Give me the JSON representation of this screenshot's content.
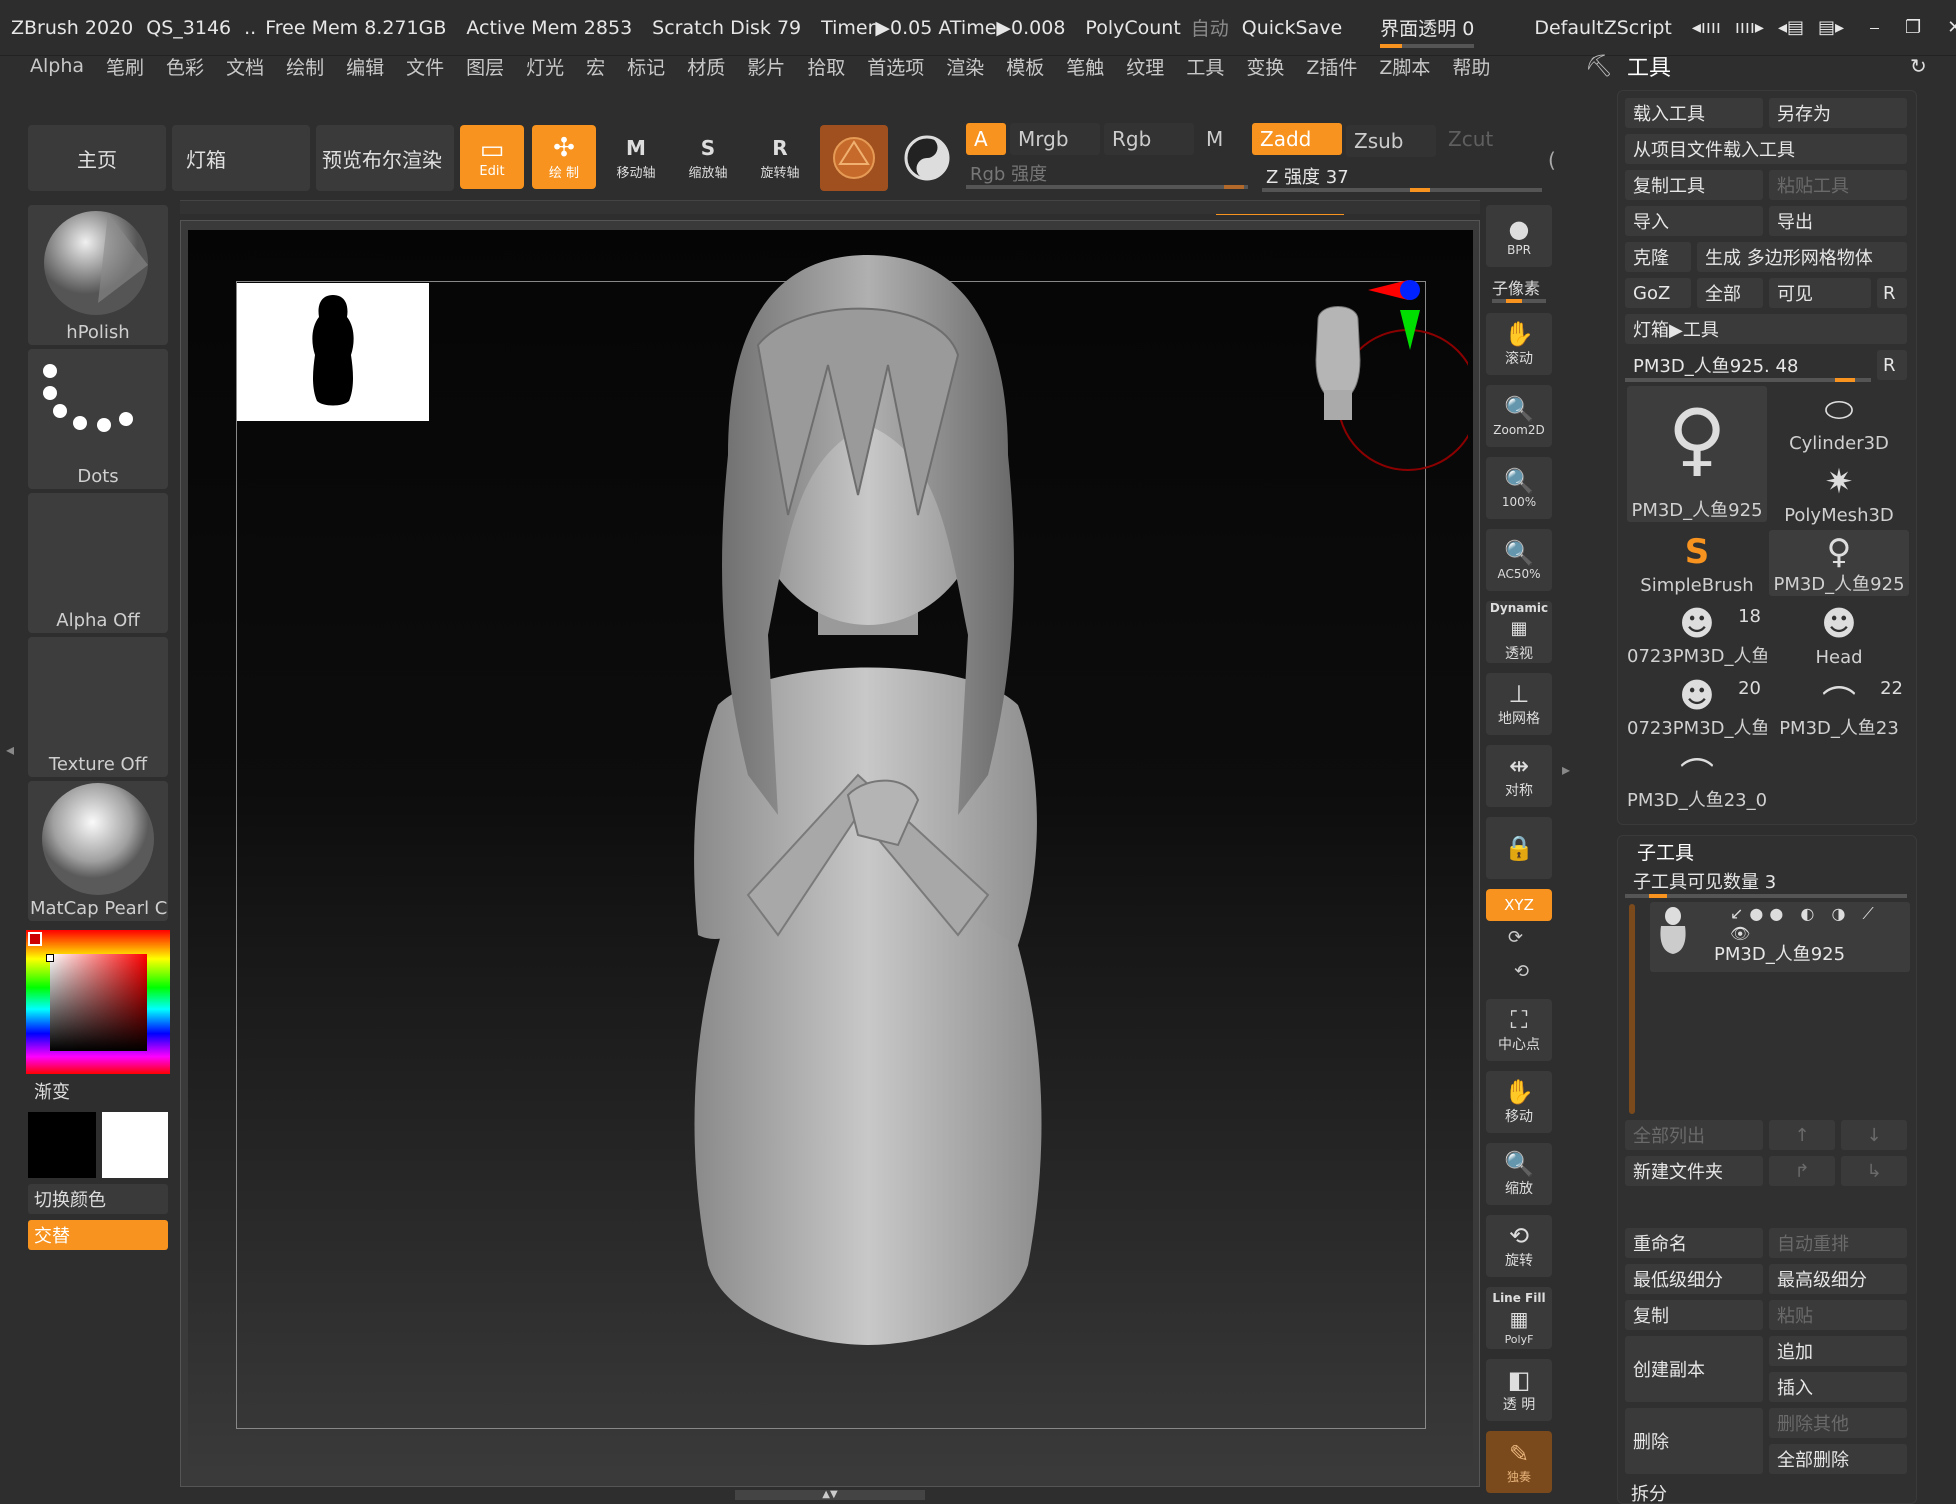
{
  "titlebar": {
    "app": "ZBrush 2020",
    "doc": "QS_3146",
    "ellipsis": "..",
    "free_mem": "Free Mem 8.271GB",
    "active_mem": "Active Mem 2853",
    "scratch": "Scratch Disk 79",
    "timer": "Timer▶0.05 ATime▶0.008",
    "polycount": "PolyCount",
    "auto": "自动",
    "quicksave": "QuickSave",
    "transparency": "界面透明 0",
    "zscript": "DefaultZScript"
  },
  "menu": [
    "Alpha",
    "笔刷",
    "色彩",
    "文档",
    "绘制",
    "编辑",
    "文件",
    "图层",
    "灯光",
    "宏",
    "标记",
    "材质",
    "影片",
    "拾取",
    "首选项",
    "渲染",
    "模板",
    "笔触",
    "纹理",
    "工具",
    "变换",
    "Z插件",
    "Z脚本",
    "帮助"
  ],
  "tool_title": "工具",
  "shelf": {
    "home": "主页",
    "lightbox": "灯箱",
    "bpr": "预览布尔渲染",
    "edit": "Edit",
    "draw": "绘 制",
    "move": "移动轴",
    "scale": "缩放轴",
    "rotate": "旋转轴",
    "move_key": "M",
    "scale_key": "S",
    "rotate_key": "R",
    "a": "A",
    "mrgb": "Mrgb",
    "rgb": "Rgb",
    "m": "M",
    "zadd": "Zadd",
    "zsub": "Zsub",
    "zcut": "Zcut",
    "rgb_intensity": "Rgb 强度",
    "z_intensity": "Z 强度 37"
  },
  "left": {
    "brush": "hPolish",
    "stroke": "Dots",
    "alpha": "Alpha Off",
    "texture": "Texture Off",
    "material": "MatCap Pearl Ca",
    "gradient": "渐变",
    "switch_color": "切换颜色",
    "alternate": "交替"
  },
  "right_strip": {
    "bpr": "BPR",
    "subpixel": "子像素",
    "scroll": "滚动",
    "zoom2d": "Zoom2D",
    "p100": "100%",
    "ac50": "AC50%",
    "dynamic": "Dynamic",
    "persp": "透视",
    "floor": "地网格",
    "sym": "对称",
    "local": "",
    "xyz": "XYZ",
    "center": "中心点",
    "move": "移动",
    "zoom": "缩放",
    "rotate": "旋转",
    "linefill": "Line Fill",
    "polyf": "PolyF",
    "transp": "透 明",
    "solo": "独奏"
  },
  "panel": {
    "load": "载入工具",
    "save_as": "另存为",
    "load_from_project": "从项目文件载入工具",
    "copy_tool": "复制工具",
    "paste_tool": "粘贴工具",
    "import": "导入",
    "export": "导出",
    "clone": "克隆",
    "make_polymesh": "生成 多边形网格物体",
    "goz": "GoZ",
    "all": "全部",
    "visible": "可见",
    "r": "R",
    "lightbox_tool": "灯箱▶工具",
    "current": "PM3D_人鱼925. 48",
    "tools": [
      {
        "name": "PM3D_人鱼925",
        "count": "",
        "icon": "figure-icon"
      },
      {
        "name": "Cylinder3D",
        "count": "",
        "icon": "cylinder-icon"
      },
      {
        "name": "PolyMesh3D",
        "count": "",
        "icon": "star-icon"
      },
      {
        "name": "SimpleBrush",
        "count": "",
        "icon": "s-brush-icon"
      },
      {
        "name": "PM3D_人鱼925",
        "count": "",
        "icon": "figure-icon"
      },
      {
        "name": "0723PM3D_人鱼",
        "count": "18",
        "icon": "head-icon"
      },
      {
        "name": "Head",
        "count": "",
        "icon": "head-icon"
      },
      {
        "name": "0723PM3D_人鱼",
        "count": "20",
        "icon": "head-icon"
      },
      {
        "name": "PM3D_人鱼23",
        "count": "22",
        "icon": "tail-icon"
      },
      {
        "name": "PM3D_人鱼23_0",
        "count": "",
        "icon": "tail-icon"
      }
    ]
  },
  "subtool": {
    "title": "子工具",
    "visible_count": "子工具可见数量 3",
    "item": "PM3D_人鱼925",
    "list_all": "全部列出",
    "new_folder": "新建文件夹",
    "rename": "重命名",
    "auto_reorder": "自动重排",
    "lowest_subdiv": "最低级细分",
    "highest_subdiv": "最高级细分",
    "copy": "复制",
    "paste": "粘贴",
    "duplicate": "创建副本",
    "append": "追加",
    "insert": "插入",
    "delete": "删除",
    "delete_other": "删除其他",
    "delete_all": "全部删除",
    "split": "拆分"
  },
  "colors": {
    "accent": "#f7931e",
    "panel": "#303030",
    "button": "#3a3a3a"
  }
}
